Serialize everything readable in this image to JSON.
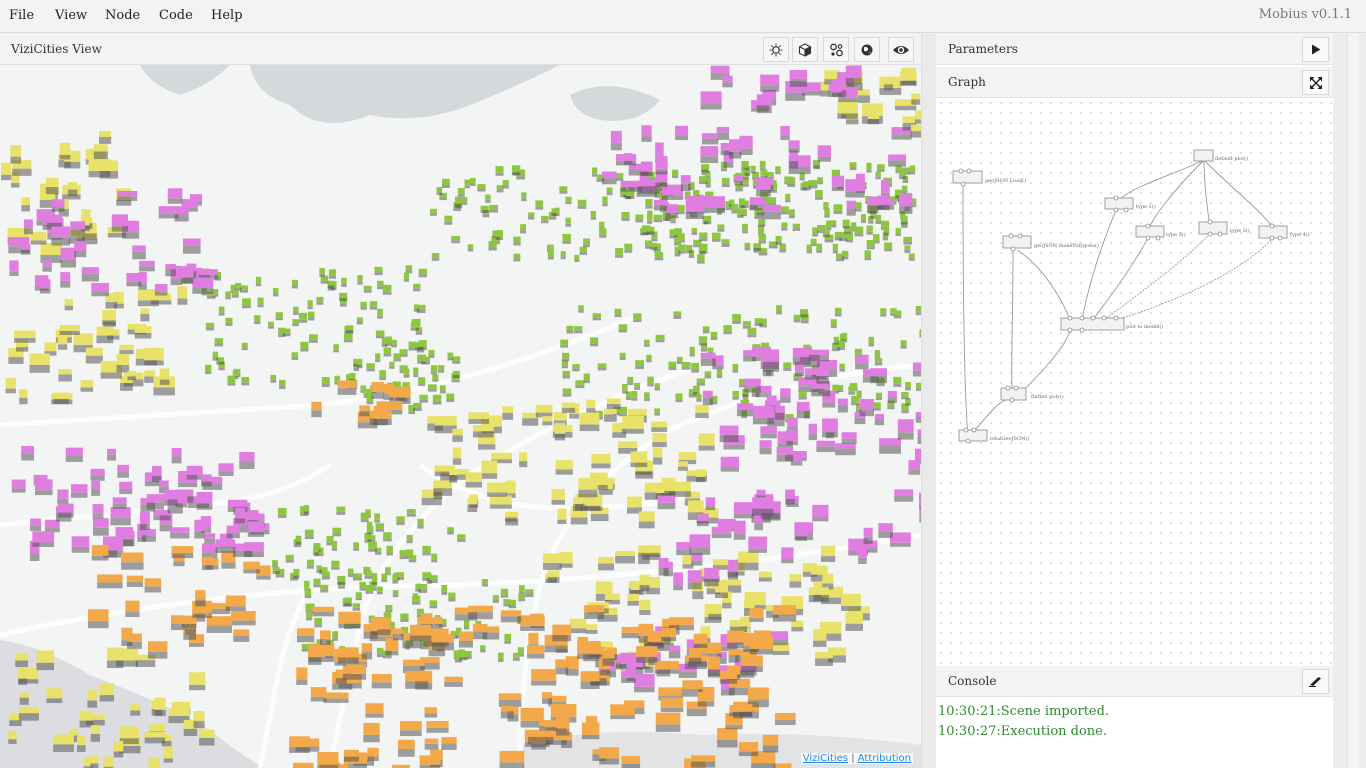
{
  "menu": {
    "items": [
      "File",
      "View",
      "Node",
      "Code",
      "Help"
    ],
    "version": "Mobius v0.1.1"
  },
  "viewer": {
    "title": "ViziCities View",
    "toolbar": [
      "sun-icon",
      "cube-icon",
      "network-icon",
      "globe-icon",
      "eye-icon"
    ],
    "attribution": {
      "link1": "ViziCities",
      "separator": "|",
      "link2": "Attribution"
    }
  },
  "parameters": {
    "title": "Parameters",
    "run_icon": "play-icon"
  },
  "graph": {
    "title": "Graph",
    "expand_icon": "expand-icon",
    "nodes": [
      "geoJSON Load()",
      "geoJSON makePolygons()",
      "flatten poly()",
      "totalGeoJSON()",
      "default plot()",
      "type 1()",
      "type 2()",
      "type 3()",
      "type 4()",
      "plot to model()"
    ]
  },
  "console": {
    "title": "Console",
    "clear_icon": "eraser-icon",
    "lines": [
      "10:30:21:Scene imported.",
      "10:30:27:Execution done."
    ]
  },
  "colors": {
    "green": "#8dc63f",
    "pink": "#e07de0",
    "yellow": "#e9e26a",
    "orange": "#f3a94a",
    "console_text": "#2e8b2e"
  }
}
